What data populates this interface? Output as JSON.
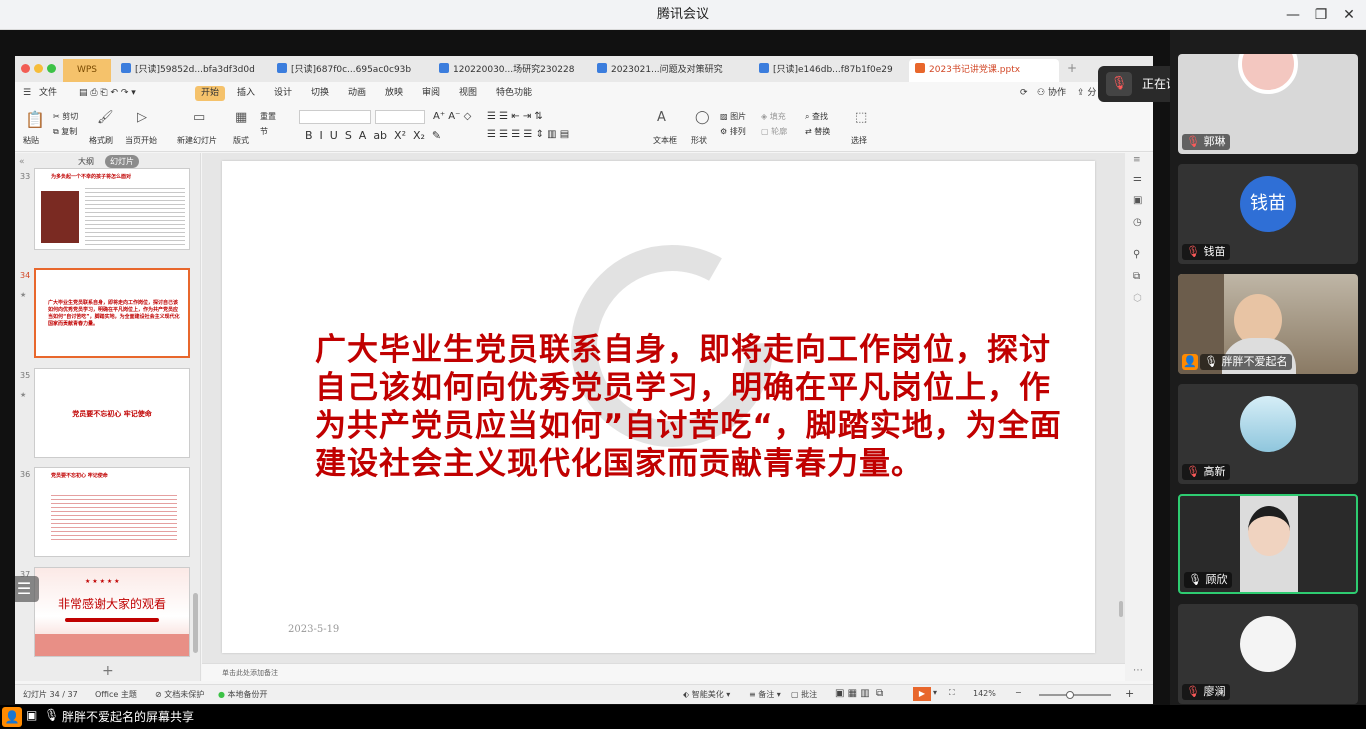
{
  "app": {
    "title": "腾讯会议"
  },
  "wps": {
    "brand_tab": "WPS",
    "tabs": [
      "[只读]59852d...bfa3df3d0d",
      "[只读]687f0c...695ac0c93b",
      "120220030...场研究230228",
      "2023021...问题及对策研究",
      "[只读]e146db...f87b1f0e29",
      "2023书记讲党课.pptx"
    ],
    "menu_file": "文件",
    "menus": [
      "开始",
      "插入",
      "设计",
      "切换",
      "动画",
      "放映",
      "审阅",
      "视图",
      "特色功能"
    ],
    "collab": "协作",
    "share_partial": "分",
    "toolbar": {
      "paste": "粘贴",
      "cut": "剪切",
      "copy": "复制",
      "format_painter": "格式刷",
      "play_current": "当页开始",
      "new_slide": "新建幻灯片",
      "layout": "版式",
      "reset": "重置",
      "section": "节",
      "textbox": "文本框",
      "shape": "形状",
      "picture": "图片",
      "arrange": "排列",
      "fill": "填充",
      "outline": "轮廓",
      "find": "查找",
      "replace": "替换",
      "select": "选择"
    },
    "pane_tabs": {
      "outline": "大纲",
      "slides": "幻灯片"
    },
    "thumbs": {
      "n33": "33",
      "t33_title": "为多负起一个不幸的孩子将怎么面对",
      "n34": "34",
      "t34_text": "广大毕业生党员联系自身，即将走向工作岗位，探讨自己该如何向优秀党员学习，明确在平凡岗位上，作为共产党员应当如何“自讨苦吃”，脚踏实地，为全面建设社会主义现代化国家而贡献青春力量。",
      "n35": "35",
      "t35_text": "党员要不忘初心 牢记使命",
      "n36": "36",
      "t36_title": "党员要不忘初心 牢记使命",
      "n37": "37",
      "t37_text": "非常感谢大家的观看"
    },
    "slide": {
      "text": "广大毕业生党员联系自身，即将走向工作岗位，探讨自己该如何向优秀党员学习，明确在平凡岗位上，作为共产党员应当如何”自讨苦吃“，脚踏实地，为全面建设社会主义现代化国家而贡献青春力量。",
      "date": "2023-5-19"
    },
    "notes_placeholder": "单击此处添加备注",
    "status": {
      "slide_count": "幻灯片 34 / 37",
      "theme": "Office 主题",
      "protect": "文档未保护",
      "backup": "本地备份开",
      "beautify": "智能美化",
      "remarks": "备注",
      "comments": "批注",
      "zoom": "142%",
      "zoom_fraction": 0.42
    }
  },
  "meeting": {
    "speaking": "正在讲话：顾欣; 胖胖不爱起名;",
    "participants": [
      {
        "name": "郭琳"
      },
      {
        "name": "钱苗",
        "avatar_text": "钱苗"
      },
      {
        "name": "胖胖不爱起名"
      },
      {
        "name": "高新"
      },
      {
        "name": "顾欣"
      },
      {
        "name": "廖澜"
      }
    ],
    "share_label": "胖胖不爱起名的屏幕共享"
  }
}
